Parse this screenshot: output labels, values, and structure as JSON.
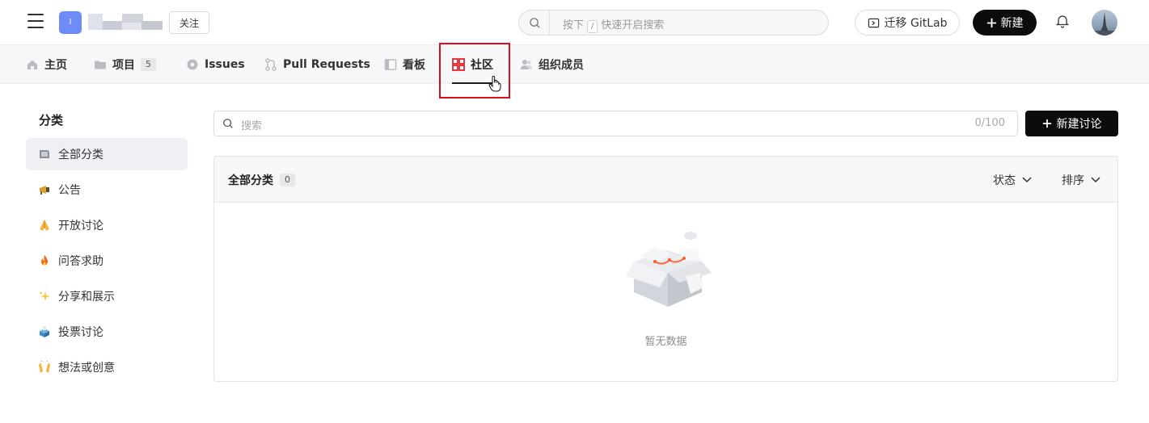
{
  "header": {
    "org_initial": "I",
    "follow_label": "关注",
    "search_hint_prefix": "按下",
    "search_hint_key": "/",
    "search_hint_suffix": "快速开启搜索",
    "migrate_label": "迁移 GitLab",
    "new_label": "新建"
  },
  "nav": {
    "tabs": [
      {
        "label": "主页",
        "icon": "home-icon"
      },
      {
        "label": "项目",
        "icon": "folder-icon",
        "count": "5"
      },
      {
        "label": "Issues",
        "icon": "issue-icon"
      },
      {
        "label": "Pull Requests",
        "icon": "pull-request-icon"
      },
      {
        "label": "看板",
        "icon": "board-icon"
      },
      {
        "label": "社区",
        "icon": "community-icon",
        "active": true
      },
      {
        "label": "组织成员",
        "icon": "members-icon"
      }
    ]
  },
  "sidebar": {
    "title": "分类",
    "items": [
      {
        "label": "全部分类",
        "icon": "folder-flag-icon",
        "active": true
      },
      {
        "label": "公告",
        "icon": "megaphone-icon"
      },
      {
        "label": "开放讨论",
        "icon": "pray-hands-icon"
      },
      {
        "label": "问答求助",
        "icon": "fire-icon"
      },
      {
        "label": "分享和展示",
        "icon": "sparkles-icon"
      },
      {
        "label": "投票讨论",
        "icon": "ballot-box-icon"
      },
      {
        "label": "想法或创意",
        "icon": "raised-hands-icon"
      }
    ]
  },
  "main": {
    "search_placeholder": "搜索",
    "search_counter": "0/100",
    "new_discussion_label": "新建讨论",
    "panel_title": "全部分类",
    "panel_count": "0",
    "status_label": "状态",
    "sort_label": "排序",
    "empty_text": "暂无数据"
  },
  "colors": {
    "accent": "#0c0c0c",
    "highlight": "#d9101c",
    "community_icon": "#e0262f"
  }
}
